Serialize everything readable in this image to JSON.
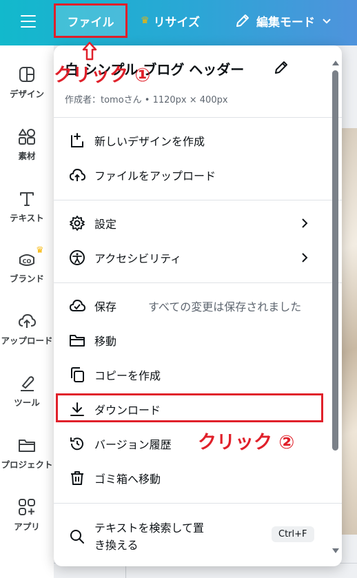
{
  "topbar": {
    "file_label": "ファイル",
    "resize_label": "リサイズ",
    "edit_mode_label": "編集モード"
  },
  "rail": {
    "items": [
      {
        "label": "デザイン",
        "icon": "design-icon"
      },
      {
        "label": "素材",
        "icon": "elements-icon"
      },
      {
        "label": "テキスト",
        "icon": "text-icon"
      },
      {
        "label": "ブランド",
        "icon": "brand-icon"
      },
      {
        "label": "アップロード",
        "icon": "upload-icon"
      },
      {
        "label": "ツール",
        "icon": "tool-icon"
      },
      {
        "label": "プロジェクト",
        "icon": "folder-icon"
      },
      {
        "label": "アプリ",
        "icon": "apps-icon"
      }
    ]
  },
  "menu": {
    "title": "白 シンプル ブログ ヘッダー",
    "subtitle": "作成者：tomoさん • 1120px × 400px",
    "items": {
      "new_design": "新しいデザインを作成",
      "upload_file": "ファイルをアップロード",
      "settings": "設定",
      "accessibility": "アクセシビリティ",
      "save": "保存",
      "save_status": "すべての変更は保存されました",
      "move": "移動",
      "make_copy": "コピーを作成",
      "download": "ダウンロード",
      "version_history": "バージョン履歴",
      "trash": "ゴミ箱へ移動",
      "find_replace_line1": "テキストを検索して置",
      "find_replace_line2": "き換える",
      "find_replace_shortcut": "Ctrl+F"
    }
  },
  "annotations": {
    "click_1": "クリック ①",
    "click_2": "クリック ②"
  },
  "colors": {
    "accent_red": "#e0202a",
    "topbar_start": "#12b9cc",
    "topbar_end": "#4f93dc",
    "crown": "#f7b500"
  }
}
